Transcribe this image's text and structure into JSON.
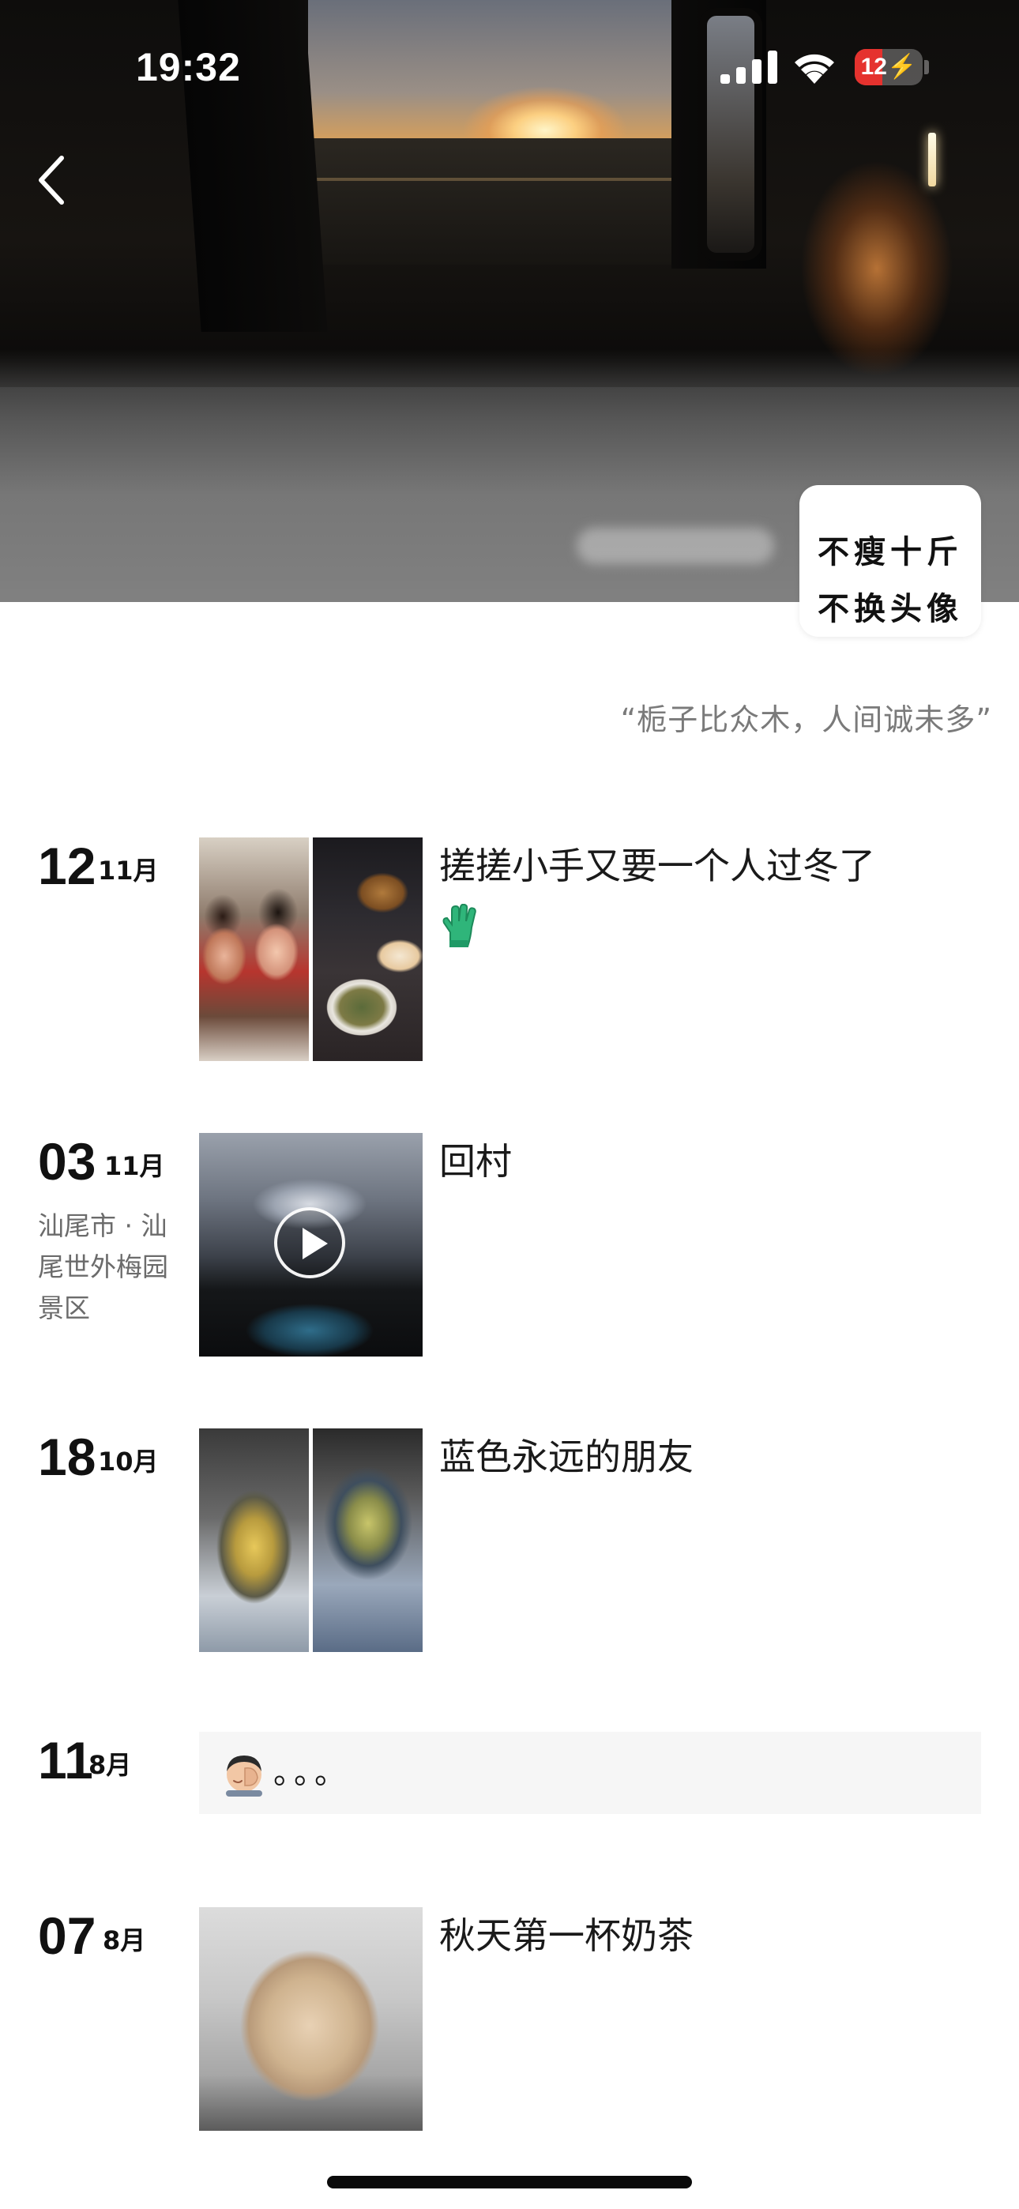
{
  "status_bar": {
    "time": "19:32",
    "battery_level": "12",
    "battery_fraction": 0.12
  },
  "cover": {
    "description_icon": "sunset-cover-photo"
  },
  "avatar": {
    "line1": "不瘦十斤",
    "line2": "不换头像"
  },
  "signature": "“栀子比众木，人间诚未多”",
  "feed": [
    {
      "day": "12",
      "month": "11月",
      "location": "",
      "text": "搓搓小手又要一个人过冬了",
      "media": "two-photos",
      "emoji": "glove-icon"
    },
    {
      "day": "03",
      "month": "11月",
      "location": "汕尾市 · 汕尾世外梅园景区",
      "text": "回村",
      "media": "video"
    },
    {
      "day": "18",
      "month": "10月",
      "location": "",
      "text": "蓝色永远的朋友",
      "media": "two-photos"
    },
    {
      "day": "11",
      "month": "8月",
      "location": "",
      "text": "。。。",
      "media": "text-only",
      "emoji": "facepalm-icon"
    },
    {
      "day": "07",
      "month": "8月",
      "location": "",
      "text": "秋天第一杯奶茶",
      "media": "photo"
    }
  ],
  "colors": {
    "background": "#ffffff",
    "text_primary": "#1a1a1a",
    "text_secondary": "#7a7a7a",
    "battery_red": "#e5322e"
  }
}
